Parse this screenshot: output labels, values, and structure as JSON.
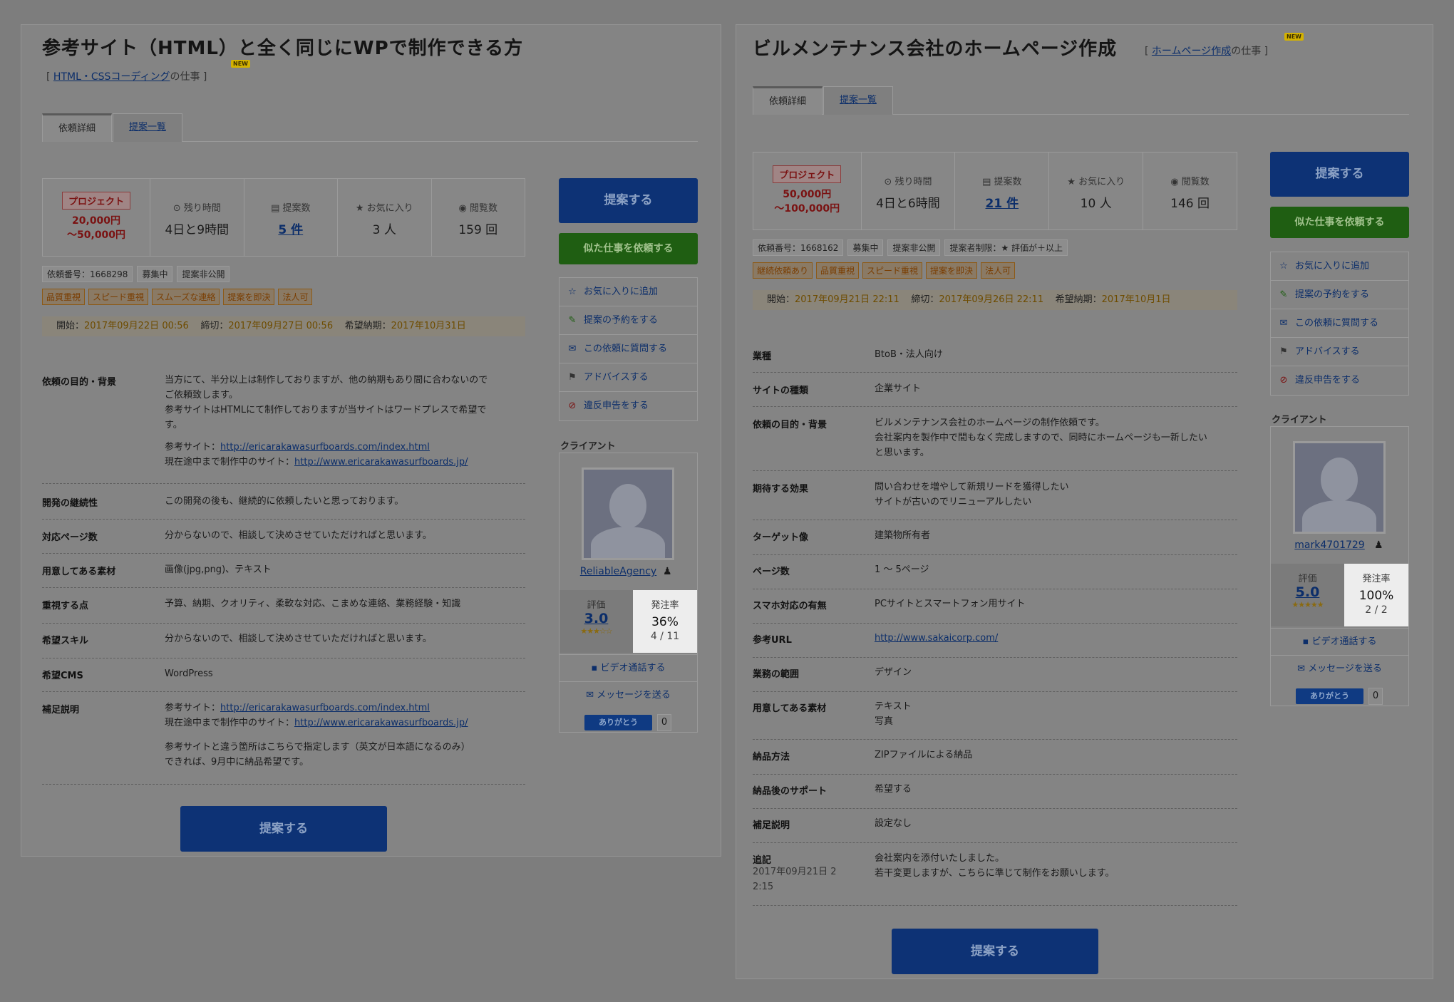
{
  "left": {
    "title": "参考サイト（HTML）と全く同じにWPで制作できる方",
    "category_prefix": "[ ",
    "category": "HTML・CSSコーディング",
    "category_suffix": "の仕事 ]",
    "new_badge": "NEW",
    "tabs": [
      "依頼詳細",
      "提案一覧"
    ],
    "stats": {
      "badge": "プロジェクト",
      "price1": "20,000円",
      "price2": "～50,000円",
      "time_label": "残り時間",
      "time_value": "4日と9時間",
      "proposals_label": "提案数",
      "proposals_value": "5 件",
      "fav_label": "お気に入り",
      "fav_value": "3 人",
      "views_label": "閲覧数",
      "views_value": "159 回"
    },
    "tags_gray": [
      "依頼番号：1668298",
      "募集中",
      "提案非公開"
    ],
    "tags_orange": [
      "品質重視",
      "スピード重視",
      "スムーズな連絡",
      "提案を即決",
      "法人可"
    ],
    "dates": {
      "start_l": "開始：",
      "start": "2017年09月22日 00:56",
      "end_l": "締切：",
      "end": "2017年09月27日 00:56",
      "due_l": "希望納期：",
      "due": "2017年10月31日"
    },
    "rows": [
      {
        "label": "依頼の目的・背景",
        "value": "当方にて、半分以上は制作しておりますが、他の納期もあり間に合わないので\nご依頼致します。\n参考サイトはHTMLにて制作しておりますが当サイトはワードプレスで希望で\nす。",
        "ref1_l": "参考サイト：",
        "ref1": "http://ericarakawasurfboards.com/index.html",
        "ref2_l": "現在途中まで制作中のサイト：",
        "ref2": "http://www.ericarakawasurfboards.jp/"
      },
      {
        "label": "開発の継続性",
        "value": "この開発の後も、継続的に依頼したいと思っております。"
      },
      {
        "label": "対応ページ数",
        "value": "分からないので、相談して決めさせていただければと思います。"
      },
      {
        "label": "用意してある素材",
        "value": "画像(jpg,png)、テキスト"
      },
      {
        "label": "重視する点",
        "value": "予算、納期、クオリティ、柔軟な対応、こまめな連絡、業務経験・知識"
      },
      {
        "label": "希望スキル",
        "value": "分からないので、相談して決めさせていただければと思います。"
      },
      {
        "label": "希望CMS",
        "value": "WordPress"
      },
      {
        "label": "補足説明",
        "ref1_l": "参考サイト：",
        "ref1": "http://ericarakawasurfboards.com/index.html",
        "ref2_l": "現在途中まで制作中のサイト：",
        "ref2": "http://www.ericarakawasurfboards.jp/",
        "note": "参考サイトと違う箇所はこちらで指定します（英文が日本語になるのみ）\nできれば、9月中に納品希望です。"
      }
    ],
    "propose_btn": "提案する",
    "similar_btn": "似た仕事を依頼する",
    "bottom_btn": "提案する",
    "menu": [
      "お気に入りに追加",
      "提案の予約をする",
      "この依頼に質問する",
      "アドバイスする",
      "違反申告をする"
    ],
    "client_label": "クライアント",
    "client": {
      "name": "ReliableAgency",
      "rating_label": "評価",
      "rating": "3.0",
      "stars": "★★★☆☆",
      "order_label": "発注率",
      "order_rate": "36%",
      "order_frac": "4 / 11",
      "video": "ビデオ通話する",
      "message": "メッセージを送る",
      "thanks": "ありがとう",
      "thanks_count": "0"
    }
  },
  "right": {
    "title": "ビルメンテナンス会社のホームページ作成",
    "category_prefix": "[ ",
    "category": "ホームページ作成",
    "category_suffix": "の仕事 ]",
    "new_badge": "NEW",
    "tabs": [
      "依頼詳細",
      "提案一覧"
    ],
    "stats": {
      "badge": "プロジェクト",
      "price1": "50,000円",
      "price2": "～100,000円",
      "time_label": "残り時間",
      "time_value": "4日と6時間",
      "proposals_label": "提案数",
      "proposals_value": "21 件",
      "fav_label": "お気に入り",
      "fav_value": "10 人",
      "views_label": "閲覧数",
      "views_value": "146 回"
    },
    "tags_gray": [
      "依頼番号：1668162",
      "募集中",
      "提案非公開",
      "提案者制限：★ 評価が＋以上"
    ],
    "tags_orange": [
      "継続依頼あり",
      "品質重視",
      "スピード重視",
      "提案を即決",
      "法人可"
    ],
    "dates": {
      "start_l": "開始：",
      "start": "2017年09月21日 22:11",
      "end_l": "締切：",
      "end": "2017年09月26日 22:11",
      "due_l": "希望納期：",
      "due": "2017年10月1日"
    },
    "rows": [
      {
        "label": "業種",
        "value": "BtoB・法人向け"
      },
      {
        "label": "サイトの種類",
        "value": "企業サイト"
      },
      {
        "label": "依頼の目的・背景",
        "value": "ビルメンテナンス会社のホームページの制作依頼です。\n会社案内を製作中で間もなく完成しますので、同時にホームページも一新したい\nと思います。"
      },
      {
        "label": "期待する効果",
        "value": "問い合わせを増やして新規リードを獲得したい\nサイトが古いのでリニューアルしたい"
      },
      {
        "label": "ターゲット像",
        "value": "建築物所有者"
      },
      {
        "label": "ページ数",
        "value": "1 ～ 5ページ"
      },
      {
        "label": "スマホ対応の有無",
        "value": "PCサイトとスマートフォン用サイト"
      },
      {
        "label": "参考URL",
        "link": "http://www.sakaicorp.com/"
      },
      {
        "label": "業務の範囲",
        "value": "デザイン"
      },
      {
        "label": "用意してある素材",
        "value": "テキスト\n写真"
      },
      {
        "label": "納品方法",
        "value": "ZIPファイルによる納品"
      },
      {
        "label": "納品後のサポート",
        "value": "希望する"
      },
      {
        "label": "補足説明",
        "value": "設定なし"
      },
      {
        "label": "追記",
        "sub": "2017年09月21日 2\n2:15",
        "value": "会社案内を添付いたしました。\n若干変更しますが、こちらに準じて制作をお願いします。"
      }
    ],
    "propose_btn": "提案する",
    "similar_btn": "似た仕事を依頼する",
    "bottom_btn": "提案する",
    "menu": [
      "お気に入りに追加",
      "提案の予約をする",
      "この依頼に質問する",
      "アドバイスする",
      "違反申告をする"
    ],
    "client_label": "クライアント",
    "client": {
      "name": "mark4701729",
      "rating_label": "評価",
      "rating": "5.0",
      "stars": "★★★★★",
      "order_label": "発注率",
      "order_rate": "100%",
      "order_frac": "2 / 2",
      "video": "ビデオ通話する",
      "message": "メッセージを送る",
      "thanks": "ありがとう",
      "thanks_count": "0"
    }
  },
  "icons": {
    "clock": "clock-icon",
    "doc": "document-icon",
    "star": "star-icon",
    "eye": "eye-icon",
    "menu": [
      "star-outline-icon",
      "reserve-icon",
      "question-icon",
      "flag-icon",
      "prohibit-icon"
    ],
    "video": "video-icon",
    "mail": "mail-icon",
    "person": "person-icon"
  },
  "colors": {
    "primary_button": "#0d3275",
    "green_button": "#1f5e12",
    "highlight": "#ededed",
    "overlay_bg": "#7d7d7d"
  }
}
